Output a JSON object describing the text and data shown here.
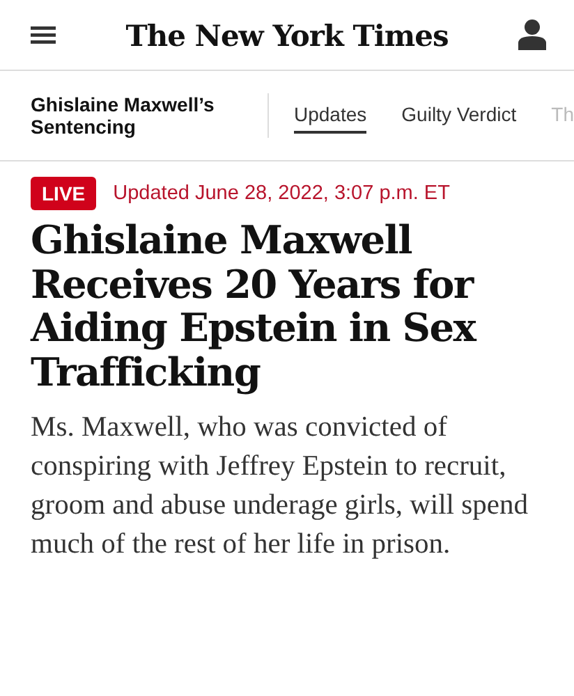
{
  "masthead": {
    "logo": "The New York Times"
  },
  "section_nav": {
    "title": "Ghislaine Maxwell’s Sentencing",
    "tabs": [
      {
        "label": "Updates",
        "selected": true
      },
      {
        "label": "Guilty Verdict",
        "selected": false
      },
      {
        "label": "Th",
        "selected": false
      }
    ]
  },
  "article": {
    "live_badge": "LIVE",
    "updated": "Updated June 28, 2022, 3:07 p.m. ET",
    "headline": "Ghislaine Maxwell Receives 20 Years for Aiding Epstein in Sex Trafficking",
    "summary": "Ms. Maxwell, who was convicted of conspiring with Jeffrey Epstein to recruit, groom and abuse underage girls, will spend much of the rest of her life in prison."
  }
}
